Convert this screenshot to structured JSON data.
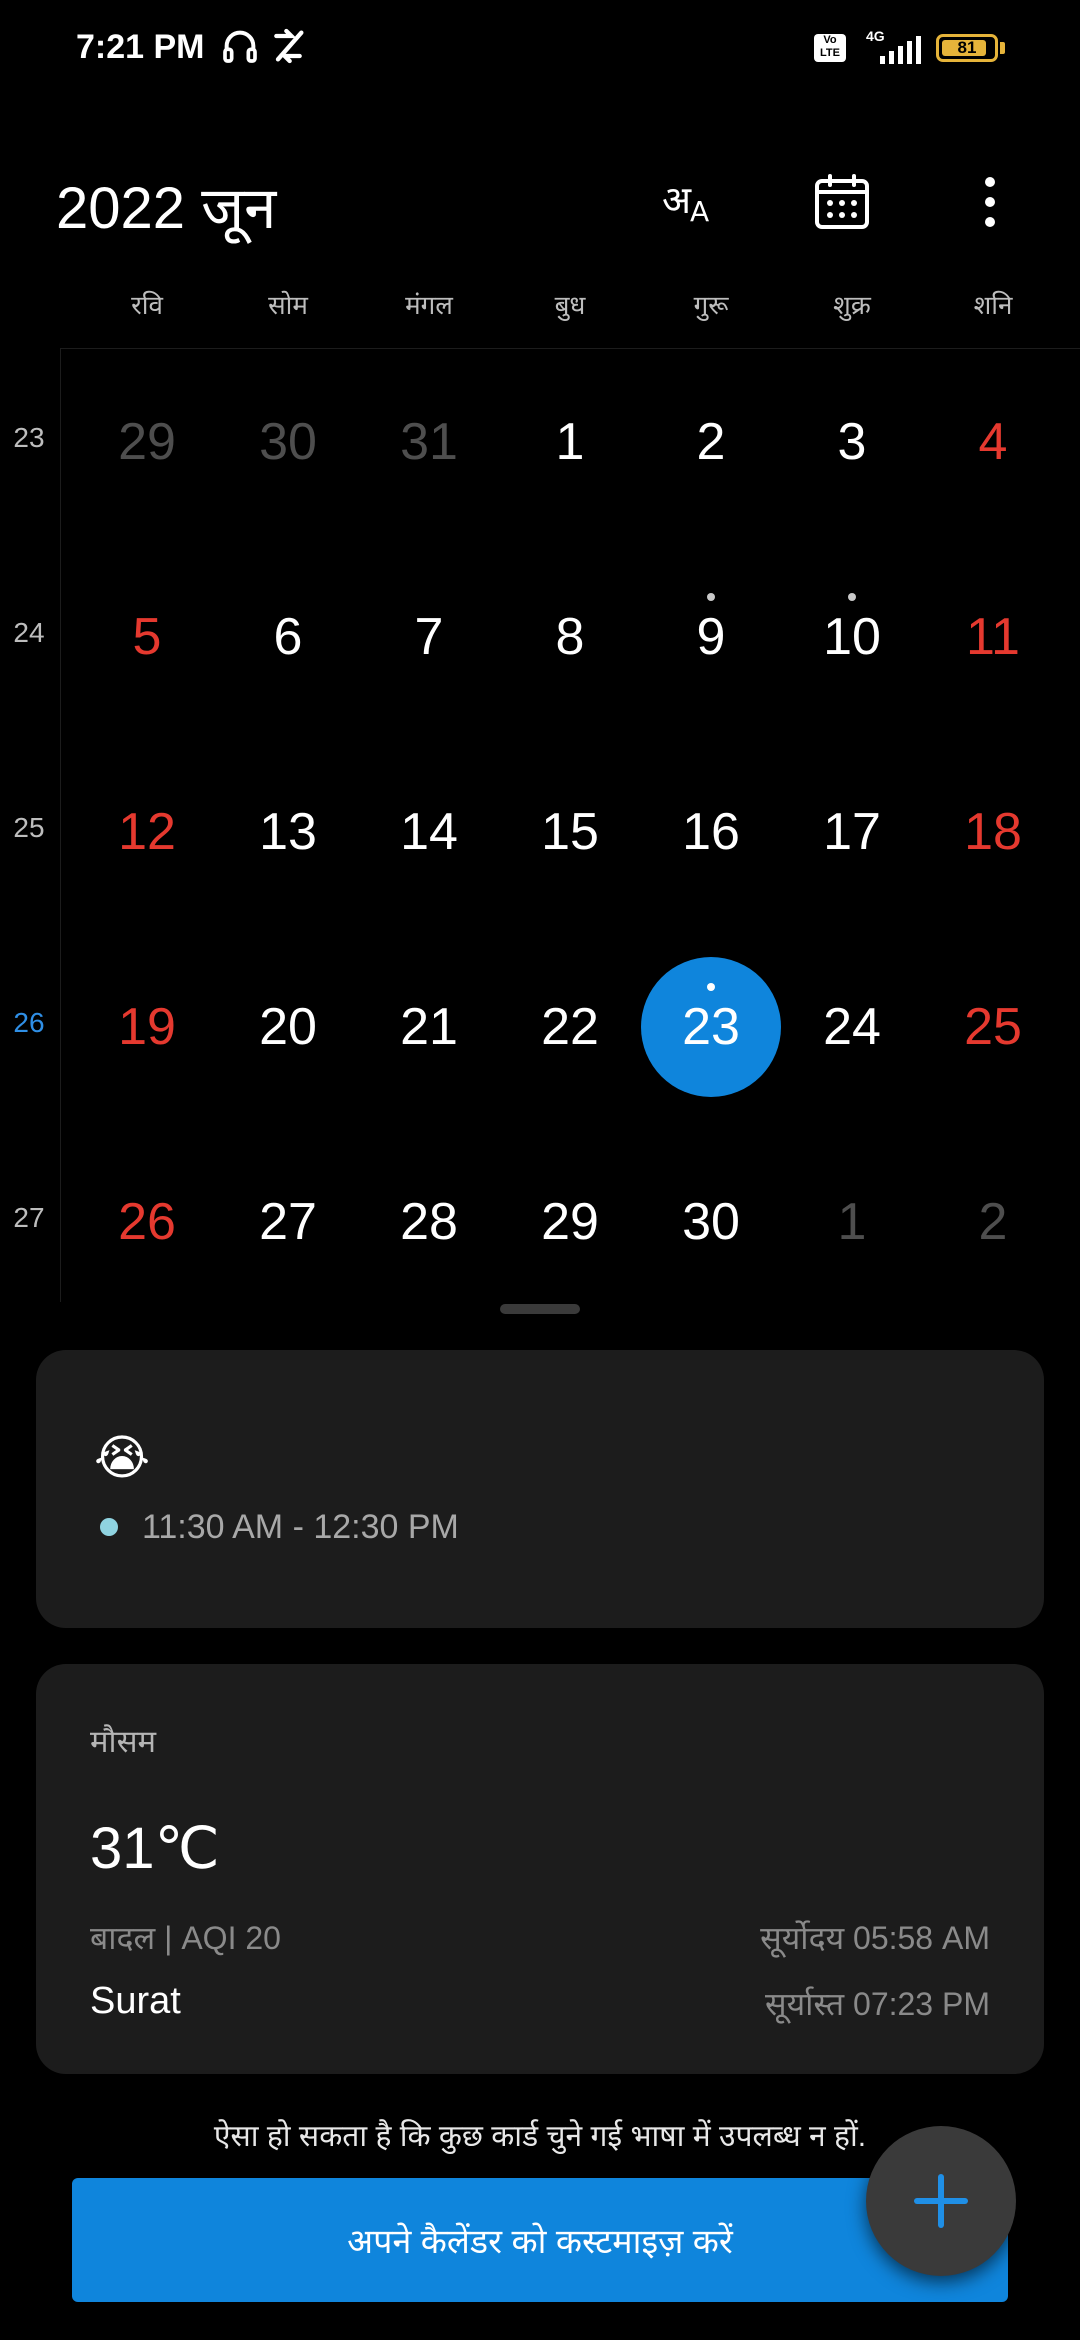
{
  "status_bar": {
    "time": "7:21 PM",
    "battery": "81",
    "network": "4G",
    "volte": "Vo LTE"
  },
  "header": {
    "title": "2022 जून",
    "language_icon": "language-icon",
    "today_icon": "calendar-icon",
    "menu_icon": "more-vert-icon"
  },
  "weekdays": [
    "रवि",
    "सोम",
    "मंगल",
    "बुध",
    "गुरू",
    "शुक्र",
    "शनि"
  ],
  "weeks": [
    {
      "num": "23",
      "days": [
        "29",
        "30",
        "31",
        "1",
        "2",
        "3",
        "4"
      ]
    },
    {
      "num": "24",
      "days": [
        "5",
        "6",
        "7",
        "8",
        "9",
        "10",
        "11"
      ]
    },
    {
      "num": "25",
      "days": [
        "12",
        "13",
        "14",
        "15",
        "16",
        "17",
        "18"
      ]
    },
    {
      "num": "26",
      "days": [
        "19",
        "20",
        "21",
        "22",
        "23",
        "24",
        "25"
      ]
    },
    {
      "num": "27",
      "days": [
        "26",
        "27",
        "28",
        "29",
        "30",
        "1",
        "2"
      ]
    }
  ],
  "event": {
    "emoji": "😭",
    "time": "11:30 AM - 12:30 PM",
    "dot_color": "#8fd3e0"
  },
  "weather": {
    "title": "मौसम",
    "temp": "31℃",
    "condition": "बादल | AQI 20",
    "city": "Surat",
    "sunrise": "सूर्योदय 05:58 AM",
    "sunset": "सूर्यास्त 07:23 PM"
  },
  "note": "ऐसा हो सकता है कि कुछ कार्ड चुने गई भाषा में उपलब्ध न हों.",
  "customize_button": "अपने कैलेंडर को कस्टमाइज़ करें",
  "colors": {
    "accent": "#0f85dc",
    "weekend": "#e5392f",
    "background": "#000000",
    "card": "#1c1c1c"
  }
}
